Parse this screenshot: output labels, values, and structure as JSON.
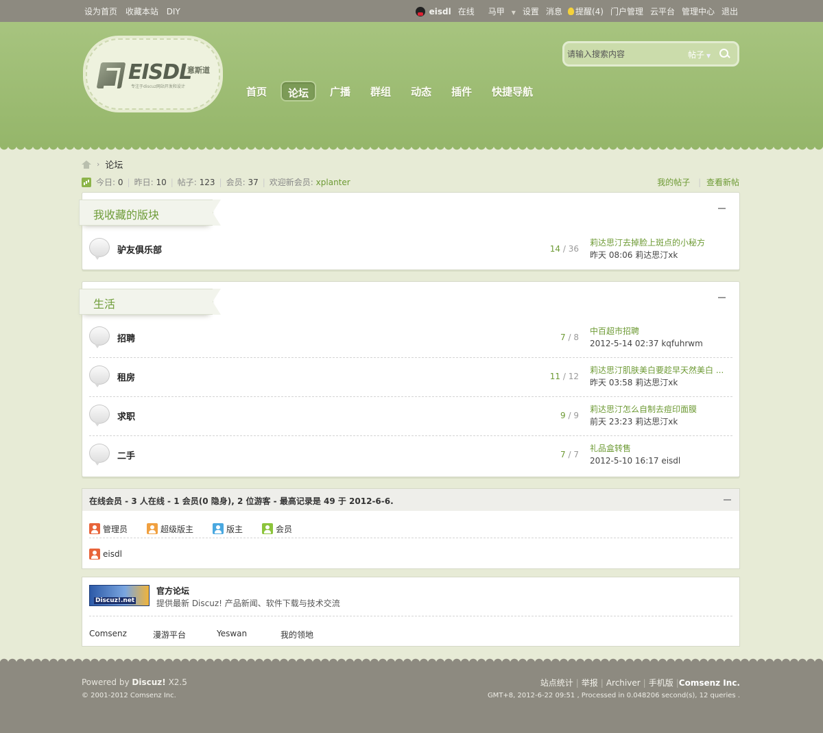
{
  "topbar": {
    "left": [
      "设为首页",
      "收藏本站",
      "DIY"
    ],
    "username": "eisdl",
    "online": "在线",
    "mahua": "马甲",
    "settings": "设置",
    "messages": "消息",
    "reminders": "提醒(4)",
    "portal_manage": "门户管理",
    "cloud": "云平台",
    "admin_center": "管理中心",
    "logout": "退出"
  },
  "logo": {
    "name": "EISDL",
    "cn": "意斯道",
    "tagline": "专注于discuz网站开发和设计"
  },
  "nav": [
    "首页",
    "论坛",
    "广播",
    "群组",
    "动态",
    "插件",
    "快捷导航"
  ],
  "nav_active_index": 1,
  "search": {
    "placeholder": "请输入搜索内容",
    "type": "帖子"
  },
  "breadcrumb": {
    "current": "论坛"
  },
  "stats": {
    "today_label": "今日:",
    "today": "0",
    "yesterday_label": "昨日:",
    "yesterday": "10",
    "posts_label": "帖子:",
    "posts": "123",
    "members_label": "会员:",
    "members": "37",
    "welcome_label": "欢迎新会员:",
    "new_member": "xplanter"
  },
  "quicklinks": {
    "my_posts": "我的帖子",
    "new_posts": "查看新帖"
  },
  "category_fav": {
    "title": "我收藏的版块",
    "forums": [
      {
        "name": "驴友俱乐部",
        "threads": "14",
        "posts": "36",
        "last_title": "莉达思汀去掉脸上斑点的小秘方",
        "last_meta": "昨天 08:06 莉达思汀xk"
      }
    ]
  },
  "category_life": {
    "title": "生活",
    "forums": [
      {
        "name": "招聘",
        "threads": "7",
        "posts": "8",
        "last_title": "中百超市招聘",
        "last_meta": "2012-5-14 02:37 kqfuhrwm"
      },
      {
        "name": "租房",
        "threads": "11",
        "posts": "12",
        "last_title": "莉达思汀肌肤美白要趁早天然美白 ...",
        "last_meta": "昨天 03:58 莉达思汀xk"
      },
      {
        "name": "求职",
        "threads": "9",
        "posts": "9",
        "last_title": "莉达思汀怎么自制去痘印面膜",
        "last_meta": "前天 23:23 莉达思汀xk"
      },
      {
        "name": "二手",
        "threads": "7",
        "posts": "7",
        "last_title": "礼品盒转售",
        "last_meta": "2012-5-10 16:17 eisdl"
      }
    ]
  },
  "online": {
    "header": "在线会员 - 3 人在线 - 1 会员(0 隐身), 2 位游客 - 最高记录是 49 于 2012-6-6.",
    "legend": [
      {
        "label": "管理员",
        "color": "#e8643a"
      },
      {
        "label": "超级版主",
        "color": "#f0a040"
      },
      {
        "label": "版主",
        "color": "#4aa8e0"
      },
      {
        "label": "会员",
        "color": "#8cc43c"
      }
    ],
    "member": "eisdl"
  },
  "links": {
    "logo_text": "Discuz!.net",
    "name": "官方论坛",
    "desc": "提供最新 Discuz! 产品新闻、软件下载与技术交流",
    "text_links": [
      "Comsenz",
      "漫游平台",
      "Yeswan",
      "我的领地"
    ]
  },
  "footer": {
    "powered_prefix": "Powered by",
    "powered_name": "Discuz!",
    "powered_version": "X2.5",
    "copyright": "© 2001-2012 Comsenz Inc.",
    "links": [
      "站点统计",
      "举报",
      "Archiver",
      "手机版"
    ],
    "company": "Comsenz Inc.",
    "gmt": "GMT+8, 2012-6-22 09:51 , Processed in 0.048206 second(s), 12 queries ."
  },
  "colors": {
    "header_green": "#a7c47f",
    "link_green": "#6d9a34",
    "footer_gray": "#8d8a80"
  }
}
